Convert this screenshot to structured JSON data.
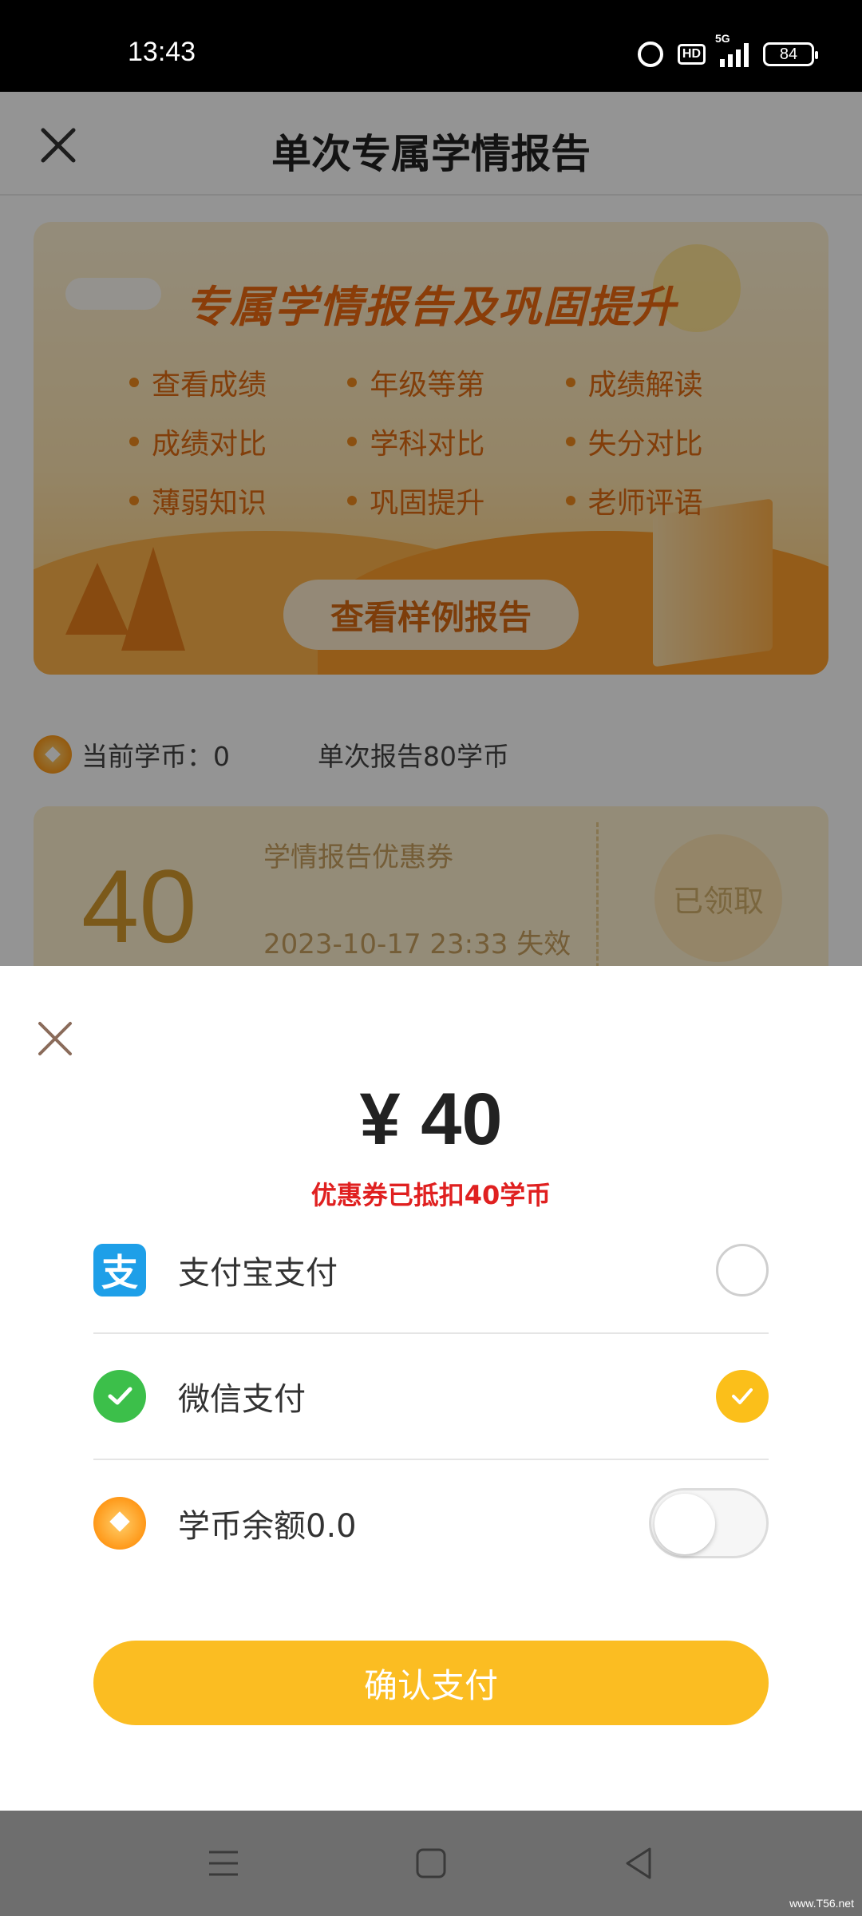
{
  "status_bar": {
    "time": "13:43",
    "hd": "HD",
    "network": "5G",
    "battery": "84"
  },
  "header": {
    "title": "单次专属学情报告"
  },
  "banner": {
    "headline": "专属学情报告及巩固提升",
    "features": [
      "查看成绩",
      "年级等第",
      "成绩解读",
      "成绩对比",
      "学科对比",
      "失分对比",
      "薄弱知识",
      "巩固提升",
      "老师评语"
    ],
    "sample_button": "查看样例报告"
  },
  "coins": {
    "current": "当前学币：0",
    "per_report": "单次报告80学币"
  },
  "coupon": {
    "amount": "40",
    "name": "学情报告优惠券",
    "expire": "2023-10-17 23:33 失效",
    "status": "已领取"
  },
  "payment": {
    "price": "¥ 40",
    "discount_note": "优惠券已抵扣40学币",
    "methods": [
      {
        "label": "支付宝支付",
        "icon": "alipay-icon",
        "selected": false
      },
      {
        "label": "微信支付",
        "icon": "wechat-pay-icon",
        "selected": true
      }
    ],
    "coin_balance_label": "学币余额0.0",
    "coin_toggle_on": false,
    "confirm_label": "确认支付"
  },
  "watermark": "www.T56.net",
  "colors": {
    "accent": "#fbbd22",
    "discount_red": "#e02020",
    "alipay": "#1e9fe8",
    "wechat": "#3cbf4a"
  }
}
